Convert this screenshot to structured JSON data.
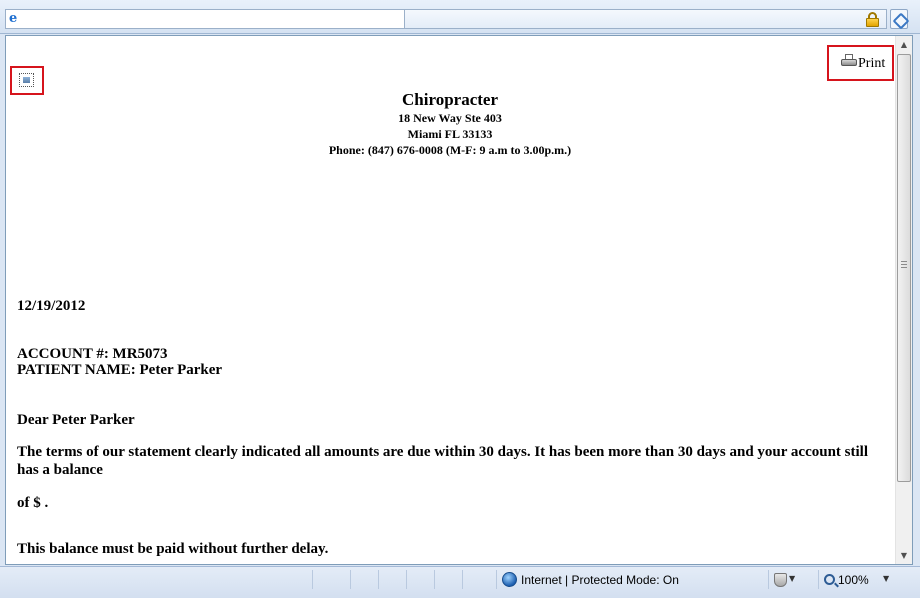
{
  "letter": {
    "clinic_name": "Chiropracter",
    "address_line1": "18 New Way Ste 403",
    "address_line2": "Miami  FL  33133",
    "phone": "Phone:  (847) 676-0008 (M-F: 9 a.m to 3.00p.m.)",
    "date": "12/19/2012",
    "account": "ACCOUNT #: MR5073",
    "patient": "PATIENT NAME: Peter Parker",
    "greeting": "Dear Peter Parker",
    "body": "The terms of our statement clearly indicated all amounts are due within 30 days. It has been more than 30 days and your account still has a balance",
    "balance": "of $ .",
    "closing": "This balance must be paid without further delay."
  },
  "toolbar": {
    "print_label": "Print"
  },
  "statusbar": {
    "zone": "Internet | Protected Mode: On",
    "zoom": "100%",
    "dropdown_glyph": "▼"
  },
  "scrollbar": {
    "up_glyph": "▲",
    "down_glyph": "▼"
  },
  "icons": {
    "browser": "e"
  }
}
